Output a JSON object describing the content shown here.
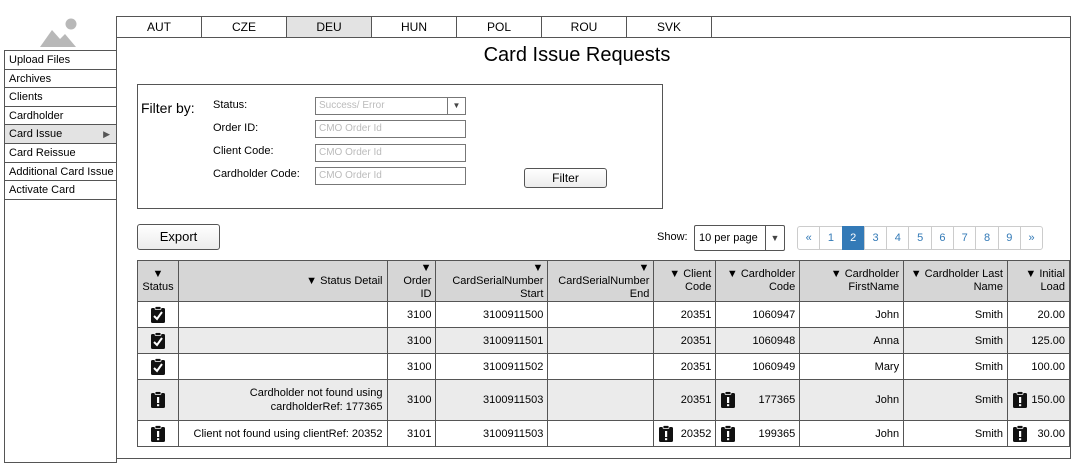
{
  "tabs": [
    "AUT",
    "CZE",
    "DEU",
    "HUN",
    "POL",
    "ROU",
    "SVK"
  ],
  "active_tab": "DEU",
  "sidebar": {
    "items": [
      {
        "label": "Upload Files"
      },
      {
        "label": "Archives"
      },
      {
        "label": "Clients"
      },
      {
        "label": "Cardholder"
      },
      {
        "label": "Card Issue",
        "active": true,
        "arrow": "▶"
      },
      {
        "label": "Card Reissue"
      },
      {
        "label": "Additional Card Issue"
      },
      {
        "label": "Activate Card"
      }
    ]
  },
  "page_title": "Card Issue Requests",
  "filter": {
    "heading": "Filter by:",
    "status_label": "Status:",
    "status_placeholder": "Success/ Error",
    "order_id_label": "Order ID:",
    "order_id_placeholder": "CMO Order Id",
    "client_code_label": "Client Code:",
    "client_code_placeholder": "CMO Order Id",
    "cardholder_code_label": "Cardholder Code:",
    "cardholder_code_placeholder": "CMO Order Id",
    "filter_button": "Filter"
  },
  "export_button": "Export",
  "show_label": "Show:",
  "per_page": "10 per page",
  "pagination": {
    "prev": "«",
    "pages": [
      "1",
      "2",
      "3",
      "4",
      "5",
      "6",
      "7",
      "8",
      "9"
    ],
    "active": "2",
    "next": "»"
  },
  "table": {
    "headers": {
      "status": "Status",
      "status_detail": "Status Detail",
      "order_id": "Order ID",
      "serial_start": "CardSerialNumber Start",
      "serial_end": "CardSerialNumber End",
      "client_code": "Client Code",
      "cardholder_code": "Cardholder Code",
      "first_name": "Cardholder FirstName",
      "last_name": "Cardholder Last Name",
      "initial_load": "Initial Load"
    },
    "sort_glyph": "▼",
    "rows": [
      {
        "status": "check-icon",
        "detail": "",
        "order_id": "3100",
        "serial_start": "3100911500",
        "serial_end": "",
        "client_code": "20351",
        "cardholder_code": "1060947",
        "first_name": "John",
        "last_name": "Smith",
        "initial_load": "20.00"
      },
      {
        "status": "check-icon",
        "detail": "",
        "order_id": "3100",
        "serial_start": "3100911501",
        "serial_end": "",
        "client_code": "20351",
        "cardholder_code": "1060948",
        "first_name": "Anna",
        "last_name": "Smith",
        "initial_load": "125.00"
      },
      {
        "status": "check-icon",
        "detail": "",
        "order_id": "3100",
        "serial_start": "3100911502",
        "serial_end": "",
        "client_code": "20351",
        "cardholder_code": "1060949",
        "first_name": "Mary",
        "last_name": "Smith",
        "initial_load": "100.00"
      },
      {
        "status": "alert-icon",
        "detail": "Cardholder not found using cardholderRef: 177365",
        "order_id": "3100",
        "serial_start": "3100911503",
        "serial_end": "",
        "client_code": "20351",
        "cardholder_code": "177365",
        "first_name": "John",
        "last_name": "Smith",
        "initial_load": "150.00"
      },
      {
        "status": "alert-icon",
        "detail": "Client not found using clientRef: 20352",
        "order_id": "3101",
        "serial_start": "3100911503",
        "serial_end": "",
        "client_code": "20352",
        "cardholder_code": "199365",
        "first_name": "John",
        "last_name": "Smith",
        "initial_load": "30.00"
      }
    ]
  }
}
